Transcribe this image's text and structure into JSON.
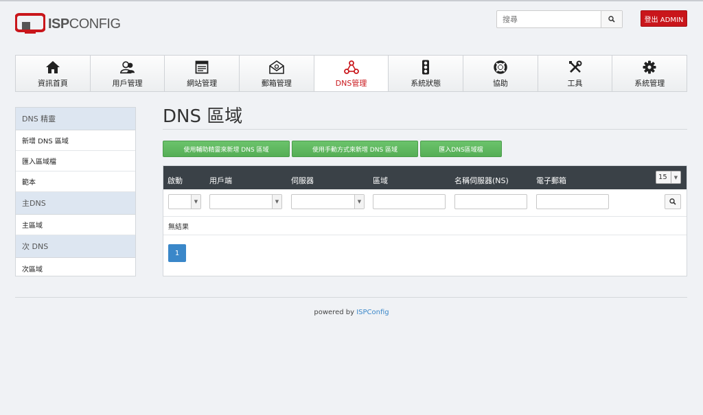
{
  "brand": {
    "logo_text_bold": "ISP",
    "logo_text_light": "CONFIG"
  },
  "header": {
    "search_placeholder": "搜尋",
    "logout_label": "登出 ADMIN"
  },
  "nav": [
    {
      "label": "資訊首頁",
      "icon": "home-icon",
      "active": false
    },
    {
      "label": "用戶管理",
      "icon": "users-icon",
      "active": false
    },
    {
      "label": "網站管理",
      "icon": "webpage-icon",
      "active": false
    },
    {
      "label": "郵箱管理",
      "icon": "mail-icon",
      "active": false
    },
    {
      "label": "DNS管理",
      "icon": "dns-network-icon",
      "active": true
    },
    {
      "label": "系統狀態",
      "icon": "traffic-light-icon",
      "active": false
    },
    {
      "label": "協助",
      "icon": "lifebuoy-icon",
      "active": false
    },
    {
      "label": "工具",
      "icon": "tools-icon",
      "active": false
    },
    {
      "label": "系統管理",
      "icon": "gear-icon",
      "active": false
    }
  ],
  "sidebar": {
    "sections": [
      {
        "heading": "DNS 精靈",
        "items": [
          "新增 DNS 區域",
          "匯入區域檔",
          "範本"
        ]
      },
      {
        "heading": "主DNS",
        "items": [
          "主區域"
        ]
      },
      {
        "heading": "次 DNS",
        "items": [
          "次區域"
        ]
      }
    ]
  },
  "main": {
    "title": "DNS 區域",
    "buttons": [
      "使用輔助精靈來新增 DNS 區域",
      "使用手動方式來新增 DNS 區域",
      "匯入DNS區域檔"
    ],
    "columns": [
      "啟動",
      "用戶端",
      "伺服器",
      "區域",
      "名稱伺服器(NS)",
      "電子郵箱"
    ],
    "page_size": "15",
    "no_results": "無結果",
    "current_page": "1"
  },
  "footer": {
    "prefix": "powered by",
    "link": "ISPConfig"
  },
  "colors": {
    "accent_red": "#c9161b",
    "green_button": "#5cb85c",
    "table_header": "#3a4147",
    "page_blue": "#3a87c9"
  }
}
